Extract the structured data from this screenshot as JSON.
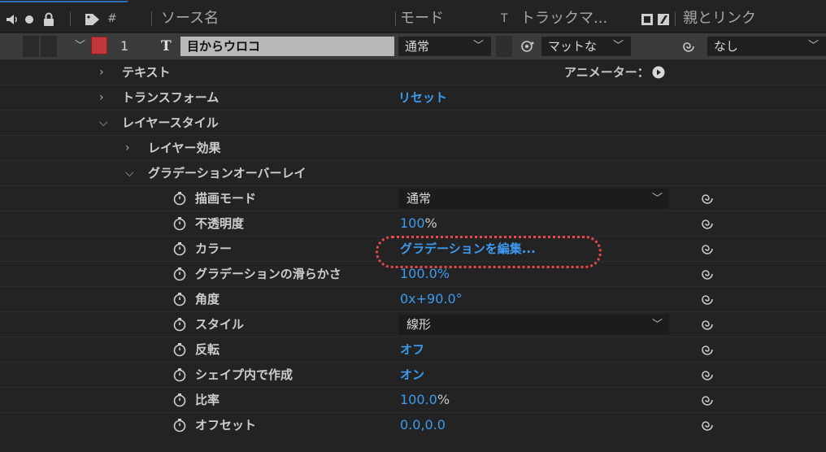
{
  "header": {
    "number_sign": "#",
    "source_name": "ソース名",
    "mode": "モード",
    "t": "T",
    "track_matte": "トラックマ...",
    "parent_link": "親とリンク"
  },
  "layer": {
    "number": "1",
    "type_icon": "T",
    "name": "目からウロコ",
    "mode": "通常",
    "matte": "マットな",
    "parent": "なし"
  },
  "groups": {
    "text": "テキスト",
    "animator": "アニメーター：",
    "transform": "トランスフォーム",
    "reset": "リセット",
    "layer_style": "レイヤースタイル",
    "layer_effect": "レイヤー効果",
    "gradient_overlay": "グラデーションオーバーレイ"
  },
  "properties": [
    {
      "label": "描画モード",
      "value": "通常",
      "kind": "select"
    },
    {
      "label": "不透明度",
      "value": "100",
      "unit": "%",
      "kind": "number"
    },
    {
      "label": "カラー",
      "value": "グラデーションを編集...",
      "kind": "link"
    },
    {
      "label": "グラデーションの滑らかさ",
      "value": "100.0%",
      "kind": "number"
    },
    {
      "label": "角度",
      "value": "0x+90.0°",
      "kind": "number"
    },
    {
      "label": "スタイル",
      "value": "線形",
      "kind": "select"
    },
    {
      "label": "反転",
      "value": "オフ",
      "kind": "link"
    },
    {
      "label": "シェイプ内で作成",
      "value": "オン",
      "kind": "link"
    },
    {
      "label": "比率",
      "value": "100.0",
      "unit": "%",
      "kind": "number"
    },
    {
      "label": "オフセット",
      "value": "0.0,0.0",
      "kind": "number"
    }
  ],
  "icons": {
    "speaker": "speaker-icon",
    "eye": "eye-icon",
    "lock": "lock-icon",
    "tag": "label-tag-icon",
    "stopwatch": "stopwatch-icon",
    "spiral": "expression-pickwhip-icon",
    "play": "play-circle-icon",
    "chevron": "chevron-down-icon"
  },
  "colors": {
    "link_blue": "#3c9bf0",
    "label_red": "#c0383a",
    "highlight": "#e5484d"
  }
}
